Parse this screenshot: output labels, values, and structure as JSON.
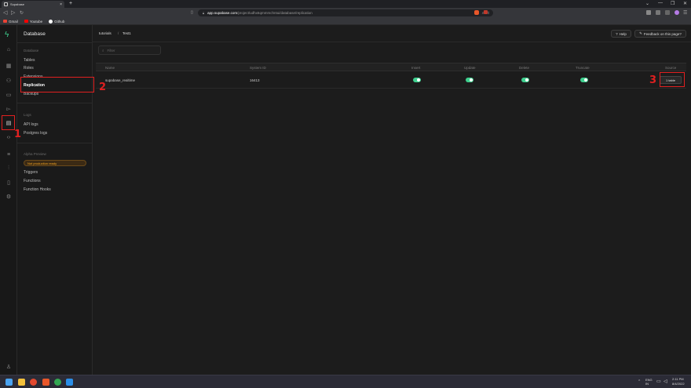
{
  "browser": {
    "tab_title": "Supabase",
    "tab_close": "×",
    "new_tab": "+",
    "window_controls": [
      "⌄",
      "—",
      "❐",
      "✕"
    ],
    "url_host": "app.supabase.com",
    "url_path": "/project/udhx6qmmmchntui/database/replication",
    "bookmarks": [
      {
        "label": "Gmail",
        "color": "#ea4335"
      },
      {
        "label": "Youtube",
        "color": "#ff0000"
      },
      {
        "label": "Github",
        "color": "#ffffff"
      }
    ]
  },
  "rail": {
    "icons": [
      "home-icon",
      "table-editor-icon",
      "auth-icon",
      "storage-icon",
      "sql-icon",
      "database-icon",
      "api-icon",
      "list-icon",
      "reports-icon",
      "docs-icon",
      "settings-icon"
    ]
  },
  "sidebar": {
    "title": "Database",
    "sections": [
      {
        "label": "Database",
        "items": [
          "Tables",
          "Roles",
          "Extensions",
          "Replication",
          "Backups"
        ]
      },
      {
        "label": "Logs",
        "items": [
          "API logs",
          "Postgres logs"
        ]
      },
      {
        "label": "Alpha Preview",
        "badge": "Not production ready",
        "items": [
          "Triggers",
          "Functions",
          "Function Hooks"
        ]
      }
    ],
    "active_item": "Replication"
  },
  "topbar": {
    "breadcrumb": [
      "tutorials",
      "Test1"
    ],
    "help_label": "Help",
    "feedback_label": "Feedback on this page?"
  },
  "filter": {
    "placeholder": "Filter"
  },
  "table": {
    "columns": [
      "Name",
      "System ID",
      "Insert",
      "Update",
      "Delete",
      "Truncate",
      "Source"
    ],
    "rows": [
      {
        "name": "supabase_realtime",
        "system_id": "16413",
        "insert": true,
        "update": true,
        "delete": true,
        "truncate": true,
        "source": "1 table"
      }
    ]
  },
  "annotations": [
    "1",
    "2",
    "3"
  ],
  "taskbar": {
    "time": "2:11 PM",
    "date": "8/4/2022",
    "lang": "ENG IN"
  },
  "colors": {
    "brand": "#3ecf8e",
    "annotation": "#e02020",
    "badge": "#f5a623"
  }
}
